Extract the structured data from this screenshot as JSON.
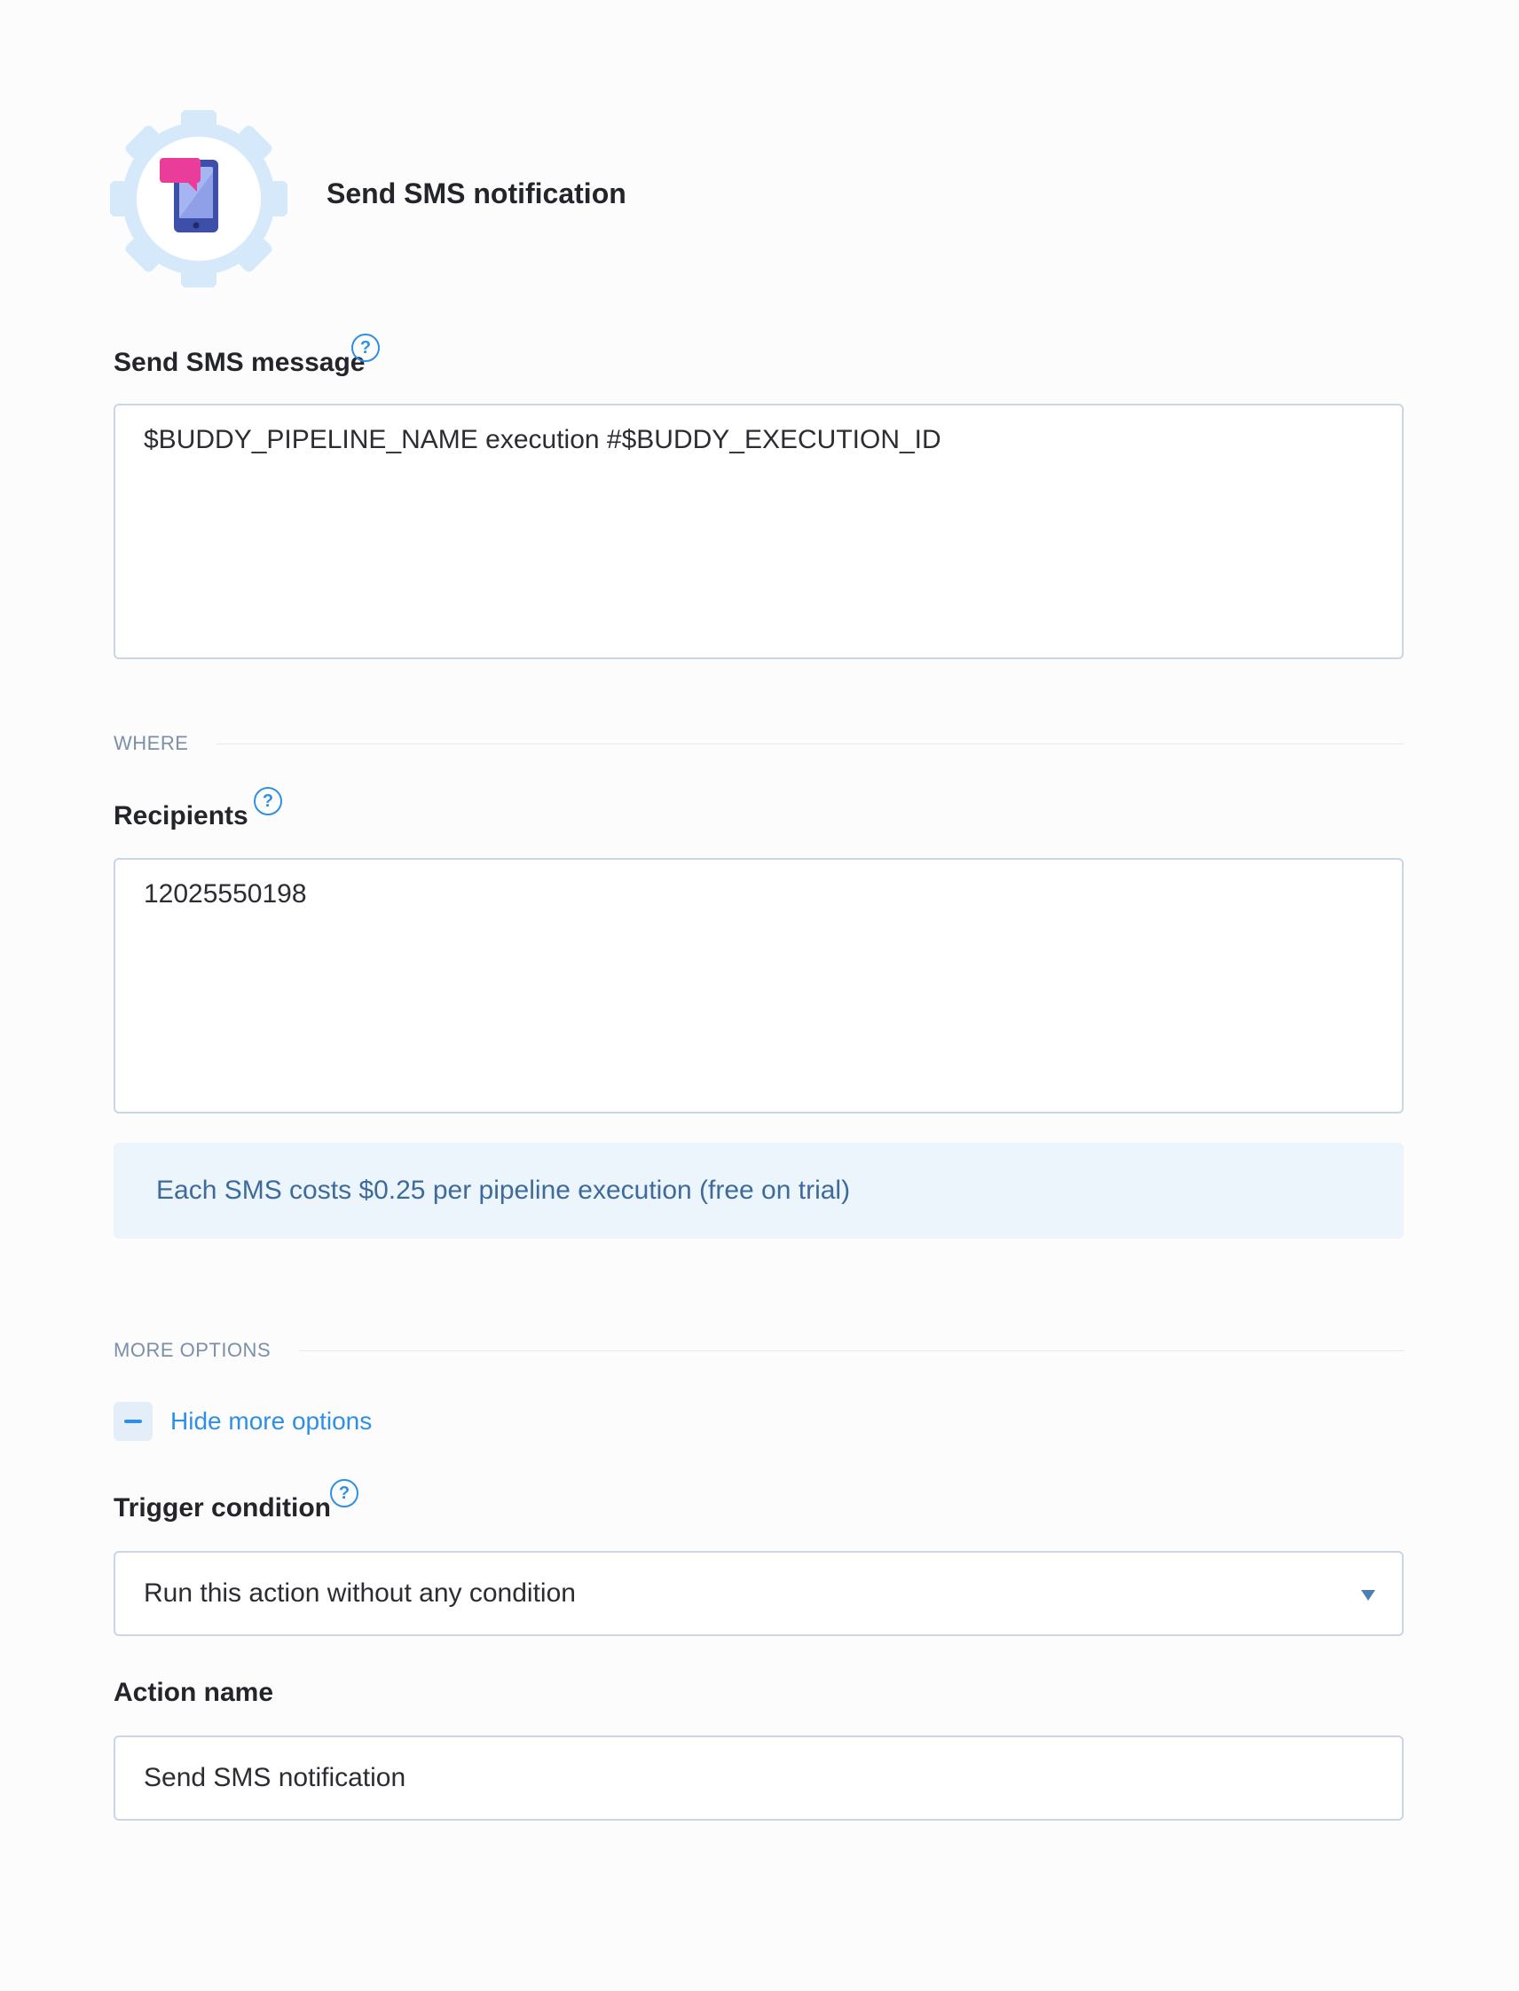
{
  "header": {
    "title": "Send SMS notification",
    "icon": "sms-phone-icon"
  },
  "message_field": {
    "label": "Send SMS message",
    "value": "$BUDDY_PIPELINE_NAME execution #$BUDDY_EXECUTION_ID"
  },
  "where_section": {
    "heading": "WHERE"
  },
  "recipients_field": {
    "label": "Recipients",
    "value": "12025550198"
  },
  "info": {
    "text": "Each SMS costs $0.25 per pipeline execution (free on trial)"
  },
  "more_options_section": {
    "heading": "MORE OPTIONS",
    "toggle_label": "Hide more options"
  },
  "trigger_condition": {
    "label": "Trigger condition",
    "selected": "Run this action without any condition"
  },
  "action_name": {
    "label": "Action name",
    "value": "Send SMS notification"
  },
  "colors": {
    "accent": "#2f8fe6",
    "gear": "#d5e9fb",
    "phone": "#3d4fa8",
    "bubble": "#ea3d9a",
    "info_bg": "#ecf5fc"
  }
}
